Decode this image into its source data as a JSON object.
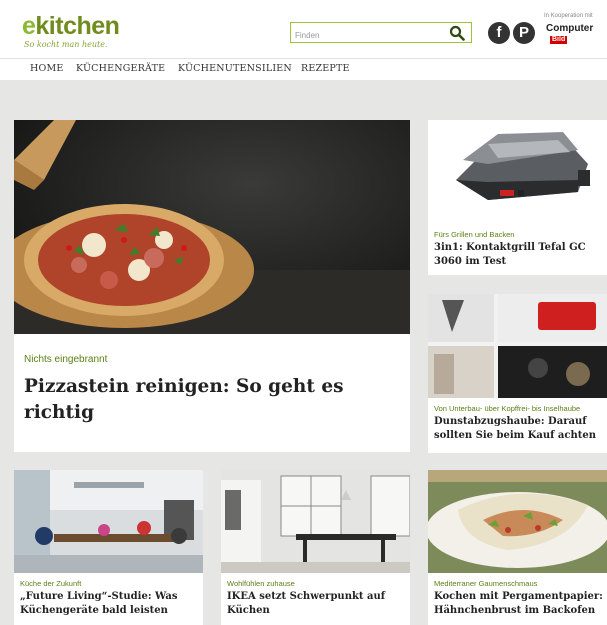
{
  "brand": {
    "name_e": "e",
    "name_rest": "kitchen",
    "tagline": "So kocht man heute."
  },
  "search": {
    "placeholder": "Finden"
  },
  "social": {
    "facebook": "f",
    "pinterest": "P"
  },
  "partner": {
    "label": "In Kooperation mit",
    "name": "Computer",
    "badge": "Bild"
  },
  "nav": [
    "HOME",
    "KÜCHENGERÄTE",
    "KÜCHENUTENSILIEN",
    "REZEPTE"
  ],
  "hero": {
    "kicker": "Nichts eingebrannt",
    "title": "Pizzastein reinigen: So geht es richtig"
  },
  "side": [
    {
      "kicker": "Fürs Grillen und Backen",
      "title": "3in1: Kontaktgrill Tefal GC 3060 im Test"
    },
    {
      "kicker": "Von Unterbau- über Kopffrei- bis Inselhaube",
      "title": "Dunstabzugshaube: Darauf sollten Sie beim Kauf achten"
    }
  ],
  "bottom": [
    {
      "kicker": "Küche der Zukunft",
      "title": "„Future Living“-Studie: Was Küchengeräte bald leisten"
    },
    {
      "kicker": "Wohlfühlen zuhause",
      "title": "IKEA setzt Schwerpunkt auf Küchen"
    },
    {
      "kicker": "Mediterraner Gaumenschmaus",
      "title": "Kochen mit Pergamentpapier: Hähnchenbrust im Backofen"
    }
  ],
  "colors": {
    "brand_green": "#6f8c1d",
    "kicker_green": "#5a7f16",
    "page_bg": "#e6e6e4",
    "search_border": "#9ac43a"
  }
}
